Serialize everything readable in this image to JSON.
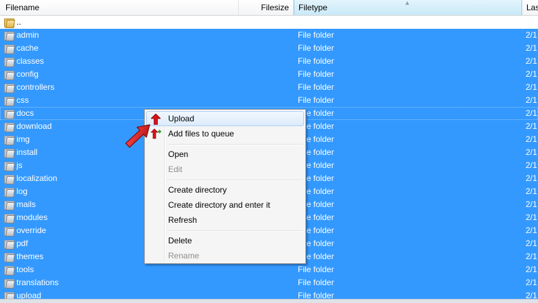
{
  "columns": {
    "filename": "Filename",
    "filesize": "Filesize",
    "filetype": "Filetype",
    "last": "Last"
  },
  "rows": [
    {
      "name": "..",
      "type": "",
      "date": "",
      "selected": false,
      "parent": true
    },
    {
      "name": "admin",
      "type": "File folder",
      "date": "2/1",
      "selected": true
    },
    {
      "name": "cache",
      "type": "File folder",
      "date": "2/1",
      "selected": true
    },
    {
      "name": "classes",
      "type": "File folder",
      "date": "2/1",
      "selected": true
    },
    {
      "name": "config",
      "type": "File folder",
      "date": "2/1",
      "selected": true
    },
    {
      "name": "controllers",
      "type": "File folder",
      "date": "2/1",
      "selected": true
    },
    {
      "name": "css",
      "type": "File folder",
      "date": "2/1",
      "selected": true
    },
    {
      "name": "docs",
      "type": "File folder",
      "date": "2/1",
      "selected": true,
      "focused": true
    },
    {
      "name": "download",
      "type": "File folder",
      "date": "2/1",
      "selected": true
    },
    {
      "name": "img",
      "type": "File folder",
      "date": "2/1",
      "selected": true
    },
    {
      "name": "install",
      "type": "File folder",
      "date": "2/1",
      "selected": true
    },
    {
      "name": "js",
      "type": "File folder",
      "date": "2/1",
      "selected": true
    },
    {
      "name": "localization",
      "type": "File folder",
      "date": "2/1",
      "selected": true
    },
    {
      "name": "log",
      "type": "File folder",
      "date": "2/1",
      "selected": true
    },
    {
      "name": "mails",
      "type": "File folder",
      "date": "2/1",
      "selected": true
    },
    {
      "name": "modules",
      "type": "File folder",
      "date": "2/1",
      "selected": true
    },
    {
      "name": "override",
      "type": "File folder",
      "date": "2/1",
      "selected": true
    },
    {
      "name": "pdf",
      "type": "File folder",
      "date": "2/1",
      "selected": true
    },
    {
      "name": "themes",
      "type": "File folder",
      "date": "2/1",
      "selected": true
    },
    {
      "name": "tools",
      "type": "File folder",
      "date": "2/1",
      "selected": true
    },
    {
      "name": "translations",
      "type": "File folder",
      "date": "2/1",
      "selected": true
    },
    {
      "name": "upload",
      "type": "File folder",
      "date": "2/1",
      "selected": true
    }
  ],
  "context_menu": {
    "upload": "Upload",
    "add_to_queue": "Add files to queue",
    "open": "Open",
    "edit": "Edit",
    "create_directory": "Create directory",
    "create_directory_enter": "Create directory and enter it",
    "refresh": "Refresh",
    "delete": "Delete",
    "rename": "Rename"
  },
  "icons": {
    "folder": "folder-icon",
    "parent": "parent-folder-icon",
    "upload": "upload-arrow-icon",
    "add_queue": "add-to-queue-icon",
    "pointer": "red-pointer-arrow-icon"
  },
  "colors": {
    "selection": "#3399ff",
    "menu_highlight": "#dcebfc",
    "pointer": "#e8141b"
  }
}
